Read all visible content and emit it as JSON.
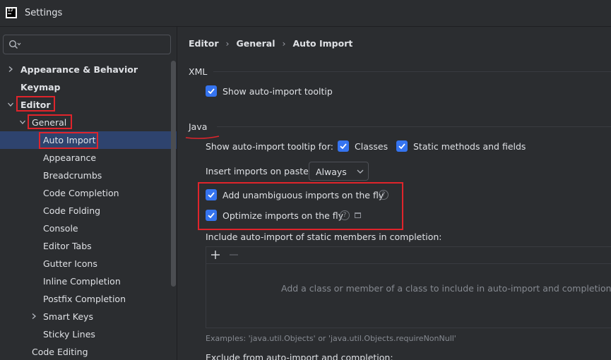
{
  "window": {
    "title": "Settings"
  },
  "search": {
    "placeholder": ""
  },
  "tree": [
    {
      "label": "Appearance & Behavior"
    },
    {
      "label": "Keymap"
    },
    {
      "label": "Editor"
    },
    {
      "label": "General"
    },
    {
      "label": "Auto Import"
    },
    {
      "label": "Appearance"
    },
    {
      "label": "Breadcrumbs"
    },
    {
      "label": "Code Completion"
    },
    {
      "label": "Code Folding"
    },
    {
      "label": "Console"
    },
    {
      "label": "Editor Tabs"
    },
    {
      "label": "Gutter Icons"
    },
    {
      "label": "Inline Completion"
    },
    {
      "label": "Postfix Completion"
    },
    {
      "label": "Smart Keys"
    },
    {
      "label": "Sticky Lines"
    },
    {
      "label": "Code Editing"
    }
  ],
  "breadcrumb": [
    "Editor",
    "General",
    "Auto Import"
  ],
  "xml": {
    "section_title": "XML",
    "show_tooltip": {
      "label": "Show auto-import tooltip",
      "checked": true
    }
  },
  "java": {
    "section_title": "Java",
    "tooltip_for_label": "Show auto-import tooltip for:",
    "classes": {
      "label": "Classes",
      "checked": true
    },
    "static_methods": {
      "label": "Static methods and fields",
      "checked": true
    },
    "insert_on_paste": {
      "label": "Insert imports on paste:",
      "value": "Always"
    },
    "add_unambiguous": {
      "label": "Add unambiguous imports on the fly",
      "checked": true
    },
    "optimize_imports": {
      "label": "Optimize imports on the fly",
      "checked": true
    },
    "include_static_label": "Include auto-import of static members in completion:",
    "include_empty_text": "Add a class or member of a class to include in auto-import and completion",
    "examples": "Examples: 'java.util.Objects' or 'java.util.Objects.requireNonNull'",
    "exclude_label": "Exclude from auto-import and completion:"
  },
  "colors": {
    "accent": "#3574f0",
    "selection": "#2e436e",
    "highlight": "#e0242b",
    "background": "#2b2d30"
  },
  "icons": [
    "app-logo-icon",
    "search-icon",
    "chevron-right-icon",
    "chevron-down-icon",
    "help-icon",
    "window-icon",
    "plus-icon",
    "minus-icon",
    "chevron-down-icon"
  ]
}
